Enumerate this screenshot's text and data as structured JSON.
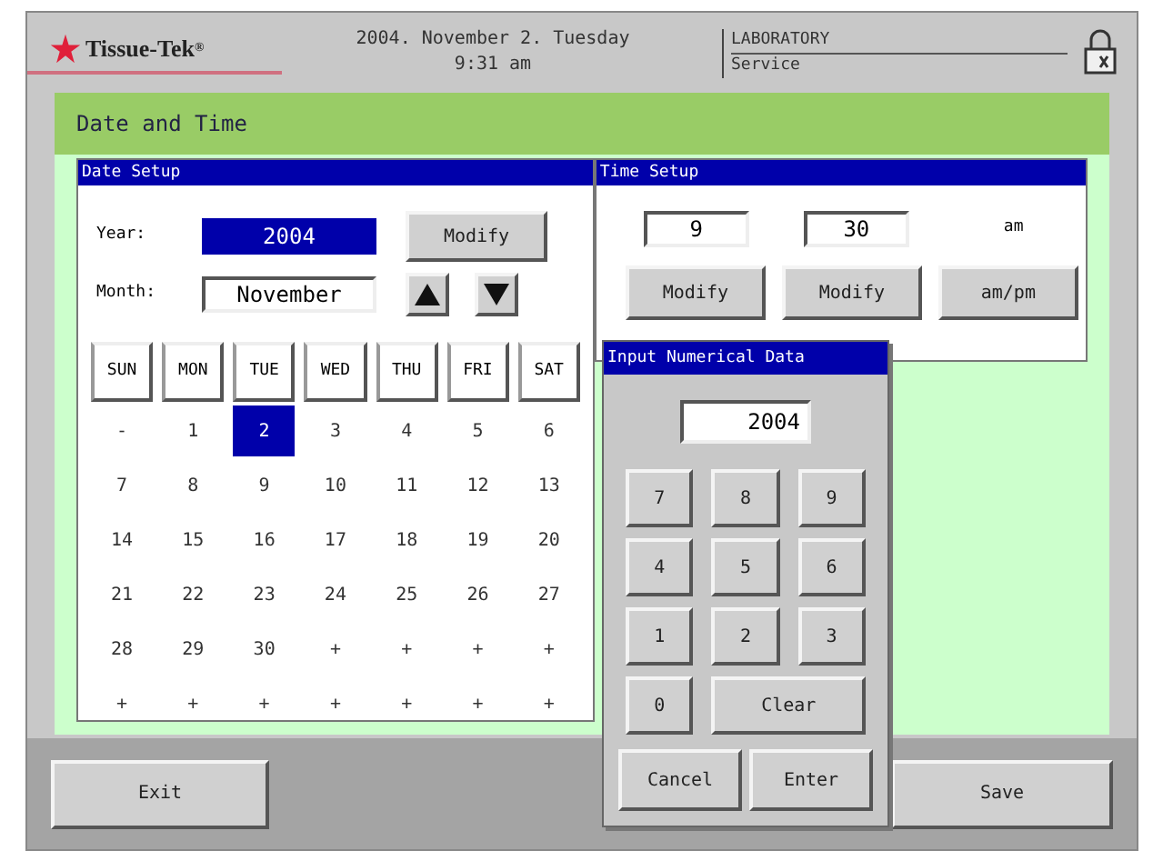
{
  "header": {
    "brand": "Tissue-Tek",
    "brand_mark": "®",
    "date": "2004. November 2. Tuesday",
    "time": "9:31 am",
    "role": "LABORATORY",
    "mode": "Service"
  },
  "panel": {
    "title": "Date and Time"
  },
  "date_setup": {
    "title": "Date Setup",
    "year_label": "Year:",
    "year": "2004",
    "modify": "Modify",
    "month_label": "Month:",
    "month": "November",
    "weekdays": [
      "SUN",
      "MON",
      "TUE",
      "WED",
      "THU",
      "FRI",
      "SAT"
    ],
    "weeks": [
      [
        {
          "text": "-",
          "selected": false
        },
        {
          "text": "1",
          "selected": false
        },
        {
          "text": "2",
          "selected": true
        },
        {
          "text": "3",
          "selected": false
        },
        {
          "text": "4",
          "selected": false
        },
        {
          "text": "5",
          "selected": false
        },
        {
          "text": "6",
          "selected": false
        }
      ],
      [
        {
          "text": "7",
          "selected": false
        },
        {
          "text": "8",
          "selected": false
        },
        {
          "text": "9",
          "selected": false
        },
        {
          "text": "10",
          "selected": false
        },
        {
          "text": "11",
          "selected": false
        },
        {
          "text": "12",
          "selected": false
        },
        {
          "text": "13",
          "selected": false
        }
      ],
      [
        {
          "text": "14",
          "selected": false
        },
        {
          "text": "15",
          "selected": false
        },
        {
          "text": "16",
          "selected": false
        },
        {
          "text": "17",
          "selected": false
        },
        {
          "text": "18",
          "selected": false
        },
        {
          "text": "19",
          "selected": false
        },
        {
          "text": "20",
          "selected": false
        }
      ],
      [
        {
          "text": "21",
          "selected": false
        },
        {
          "text": "22",
          "selected": false
        },
        {
          "text": "23",
          "selected": false
        },
        {
          "text": "24",
          "selected": false
        },
        {
          "text": "25",
          "selected": false
        },
        {
          "text": "26",
          "selected": false
        },
        {
          "text": "27",
          "selected": false
        }
      ],
      [
        {
          "text": "28",
          "selected": false
        },
        {
          "text": "29",
          "selected": false
        },
        {
          "text": "30",
          "selected": false
        },
        {
          "text": "+",
          "selected": false
        },
        {
          "text": "+",
          "selected": false
        },
        {
          "text": "+",
          "selected": false
        },
        {
          "text": "+",
          "selected": false
        }
      ],
      [
        {
          "text": "+",
          "selected": false
        },
        {
          "text": "+",
          "selected": false
        },
        {
          "text": "+",
          "selected": false
        },
        {
          "text": "+",
          "selected": false
        },
        {
          "text": "+",
          "selected": false
        },
        {
          "text": "+",
          "selected": false
        },
        {
          "text": "+",
          "selected": false
        }
      ]
    ]
  },
  "time_setup": {
    "title": "Time Setup",
    "hour": "9",
    "minute": "30",
    "ampm": "am",
    "buttons": [
      "Modify",
      "Modify",
      "am/pm"
    ]
  },
  "numeric_dialog": {
    "title": "Input Numerical Data",
    "value": "2004",
    "keys": [
      {
        "label": "7",
        "kind": "digit"
      },
      {
        "label": "8",
        "kind": "digit"
      },
      {
        "label": "9",
        "kind": "digit"
      },
      {
        "label": "4",
        "kind": "digit"
      },
      {
        "label": "5",
        "kind": "digit"
      },
      {
        "label": "6",
        "kind": "digit"
      },
      {
        "label": "1",
        "kind": "digit"
      },
      {
        "label": "2",
        "kind": "digit"
      },
      {
        "label": "3",
        "kind": "digit"
      },
      {
        "label": "0",
        "kind": "digit"
      },
      {
        "label": "Clear",
        "kind": "wide"
      }
    ],
    "actions": [
      "Cancel",
      "Enter"
    ]
  },
  "footer": {
    "exit": "Exit",
    "save": "Save"
  }
}
